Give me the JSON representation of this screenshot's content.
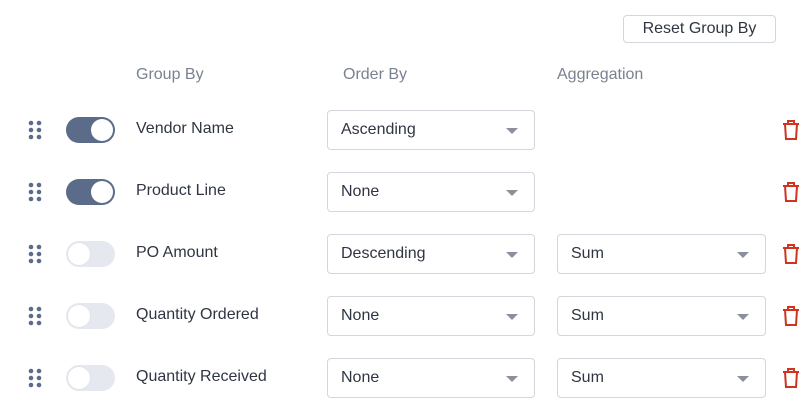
{
  "reset_label": "Reset Group By",
  "headers": {
    "group_by": "Group By",
    "order_by": "Order By",
    "aggregation": "Aggregation"
  },
  "colors": {
    "toggle_on": "#5b6b8a",
    "toggle_off": "#e5e9ef",
    "delete_red": "#d0341f"
  },
  "rows": [
    {
      "name": "Vendor Name",
      "enabled": true,
      "order": "Ascending",
      "aggregation": null
    },
    {
      "name": "Product Line",
      "enabled": true,
      "order": "None",
      "aggregation": null
    },
    {
      "name": "PO Amount",
      "enabled": false,
      "order": "Descending",
      "aggregation": "Sum"
    },
    {
      "name": "Quantity Ordered",
      "enabled": false,
      "order": "None",
      "aggregation": "Sum"
    },
    {
      "name": "Quantity Received",
      "enabled": false,
      "order": "None",
      "aggregation": "Sum"
    }
  ]
}
